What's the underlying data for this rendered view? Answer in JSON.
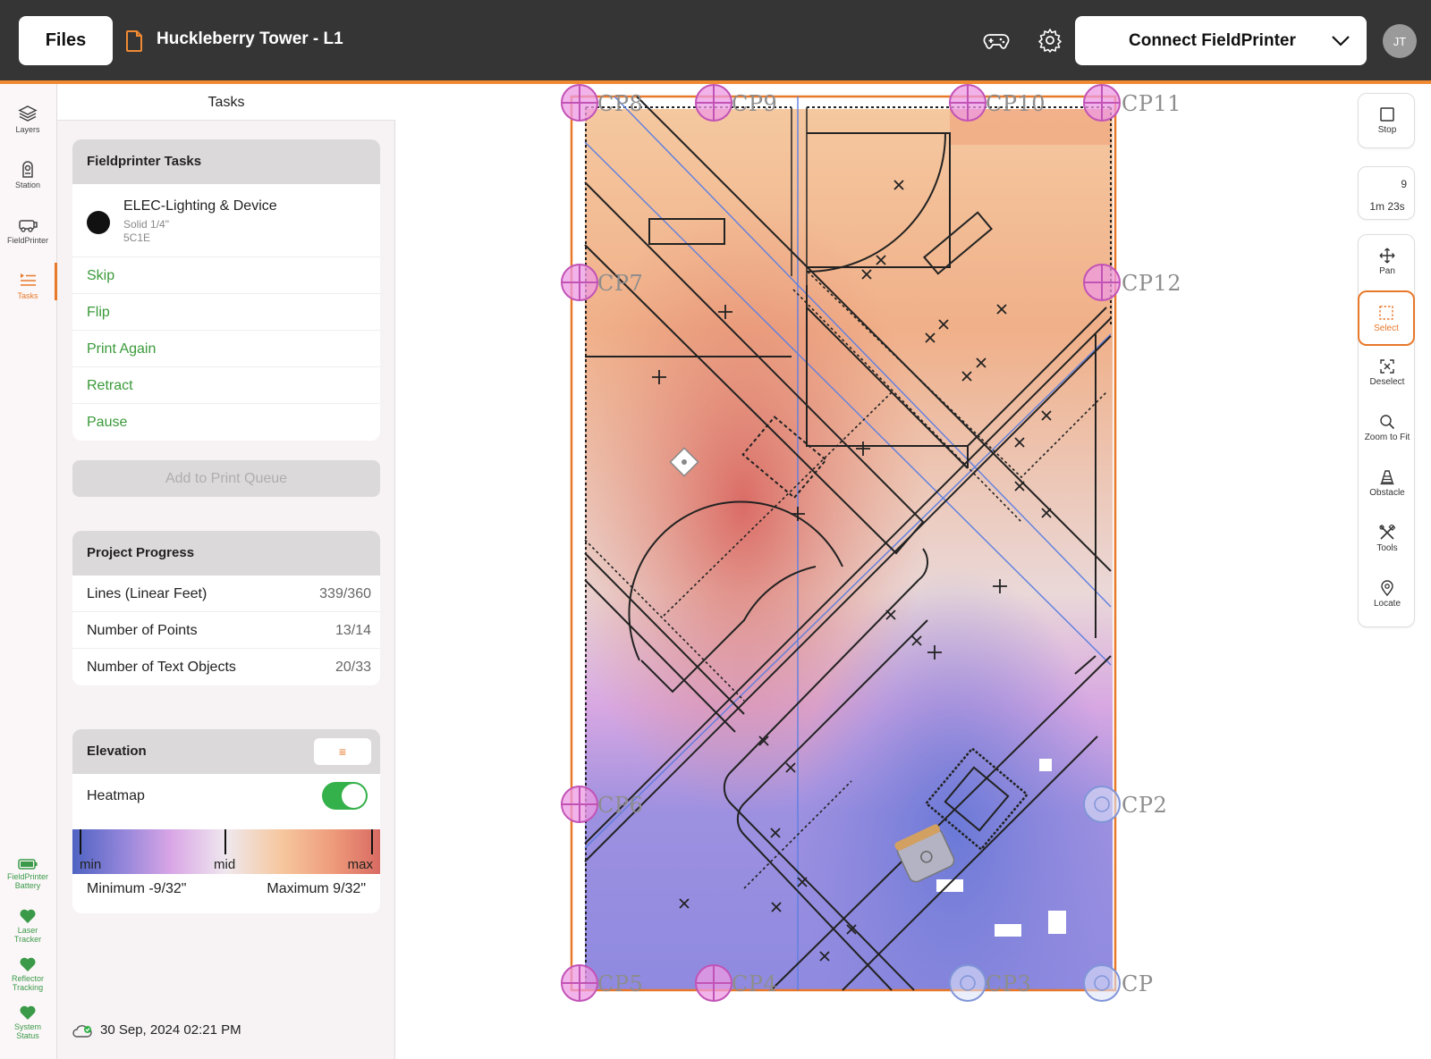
{
  "header": {
    "files_label": "Files",
    "document_title": "Huckleberry Tower - L1",
    "connect_label": "Connect FieldPrinter",
    "avatar_initials": "JT",
    "accent_color": "#f08a32"
  },
  "rail": {
    "items": [
      {
        "label": "Layers",
        "icon": "layers-icon"
      },
      {
        "label": "Station",
        "icon": "station-icon"
      },
      {
        "label": "FieldPrinter",
        "icon": "fieldprinter-icon"
      },
      {
        "label": "Tasks",
        "icon": "tasks-icon",
        "active": true
      }
    ],
    "status": [
      {
        "label_line1": "FieldPrinter",
        "label_line2": "Battery",
        "icon": "battery-icon"
      },
      {
        "label_line1": "Laser",
        "label_line2": "Tracker",
        "icon": "heart-icon"
      },
      {
        "label_line1": "Reflector",
        "label_line2": "Tracking",
        "icon": "heart-icon"
      },
      {
        "label_line1": "System",
        "label_line2": "Status",
        "icon": "heart-icon"
      }
    ]
  },
  "panel": {
    "title": "Tasks",
    "fieldprinter_tasks": {
      "header": "Fieldprinter Tasks",
      "task": {
        "name": "ELEC-Lighting & Device",
        "style": "Solid   1/4\"",
        "code": "5C1E",
        "color": "#111111"
      },
      "actions": [
        "Skip",
        "Flip",
        "Print Again",
        "Retract",
        "Pause"
      ]
    },
    "queue_label": "Add to Print Queue",
    "progress": {
      "header": "Project Progress",
      "rows": [
        {
          "label": "Lines (Linear Feet)",
          "value": "339/360"
        },
        {
          "label": "Number of Points",
          "value": "13/14"
        },
        {
          "label": "Number of Text Objects",
          "value": "20/33"
        }
      ]
    },
    "elevation": {
      "header": "Elevation",
      "menu_icon": "≡",
      "heatmap_label": "Heatmap",
      "heatmap_on": true,
      "scale_min": "min",
      "scale_mid": "mid",
      "scale_max": "max",
      "minimum": "Minimum  -9/32\"",
      "maximum": "Maximum  9/32\""
    },
    "timestamp": "30 Sep, 2024 02:21 PM"
  },
  "map": {
    "control_points": [
      "CP8",
      "CP9",
      "CP10",
      "CP11",
      "CP7",
      "CP12",
      "CP6",
      "CP2",
      "CP5",
      "CP4",
      "CP3",
      "CP"
    ]
  },
  "toolbar": {
    "stop_label": "Stop",
    "count_value": "9",
    "count_time": "1m 23s",
    "tools": [
      {
        "label": "Pan",
        "icon": "pan-icon"
      },
      {
        "label": "Select",
        "icon": "select-icon",
        "active": true
      },
      {
        "label": "Deselect",
        "icon": "deselect-icon"
      },
      {
        "label": "Zoom to Fit",
        "icon": "zoom-icon"
      },
      {
        "label": "Obstacle",
        "icon": "obstacle-icon"
      },
      {
        "label": "Tools",
        "icon": "tools-icon"
      },
      {
        "label": "Locate",
        "icon": "locate-icon"
      }
    ]
  }
}
